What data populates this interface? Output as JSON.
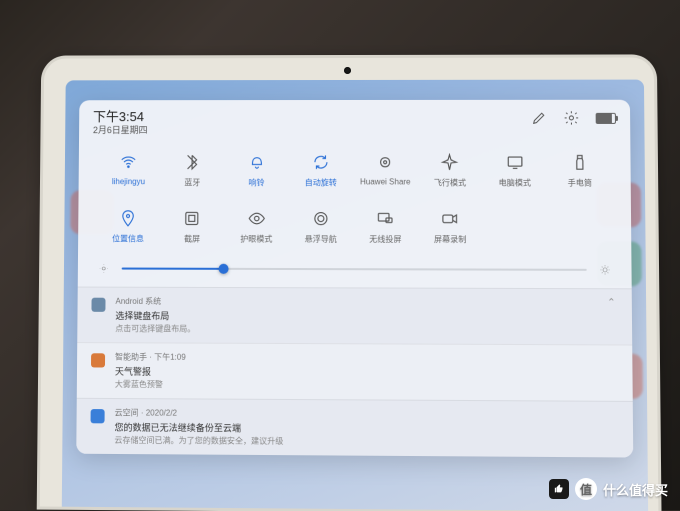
{
  "header": {
    "time": "下午3:54",
    "date": "2月6日星期四"
  },
  "quick_settings": {
    "row1": [
      {
        "label": "lihejingyu",
        "icon": "wifi",
        "active": true
      },
      {
        "label": "蓝牙",
        "icon": "bluetooth",
        "active": false
      },
      {
        "label": "响铃",
        "icon": "bell",
        "active": true
      },
      {
        "label": "自动旋转",
        "icon": "rotate",
        "active": true
      },
      {
        "label": "Huawei Share",
        "icon": "share",
        "active": false
      },
      {
        "label": "飞行模式",
        "icon": "airplane",
        "active": false
      },
      {
        "label": "电脑模式",
        "icon": "desktop",
        "active": false
      },
      {
        "label": "手电筒",
        "icon": "flashlight",
        "active": false
      }
    ],
    "row2": [
      {
        "label": "位置信息",
        "icon": "location",
        "active": true
      },
      {
        "label": "截屏",
        "icon": "screenshot",
        "active": false
      },
      {
        "label": "护眼模式",
        "icon": "eye",
        "active": false
      },
      {
        "label": "悬浮导航",
        "icon": "float",
        "active": false
      },
      {
        "label": "无线投屏",
        "icon": "cast",
        "active": false
      },
      {
        "label": "屏幕录制",
        "icon": "record",
        "active": false
      }
    ]
  },
  "brightness": {
    "percent": 22
  },
  "notifications": [
    {
      "source": "Android 系统",
      "title": "选择键盘布局",
      "text": "点击可选择键盘布局。",
      "icon_color": "#6b8aa8"
    },
    {
      "source": "智能助手",
      "time": "下午1:09",
      "title": "天气警报",
      "text": "大雾蓝色预警",
      "icon_color": "#d97a3a"
    },
    {
      "source": "云空间",
      "time": "2020/2/2",
      "title": "您的数据已无法继续备份至云端",
      "text": "云存储空间已满。为了您的数据安全，建议升级",
      "icon_color": "#3a7fd9"
    }
  ],
  "watermark": {
    "badge": "值",
    "text": "什么值得买"
  }
}
